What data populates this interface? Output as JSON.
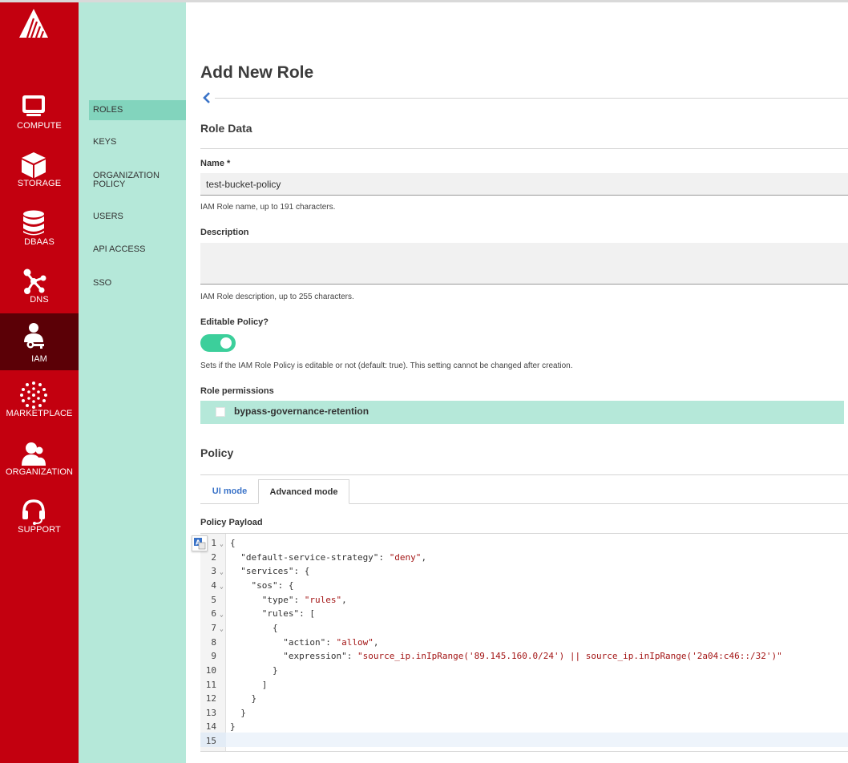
{
  "nav": {
    "items": [
      {
        "label": "COMPUTE",
        "icon": "monitor-icon"
      },
      {
        "label": "STORAGE",
        "icon": "cube-icon"
      },
      {
        "label": "DBAAS",
        "icon": "database-icon"
      },
      {
        "label": "DNS",
        "icon": "network-icon"
      },
      {
        "label": "IAM",
        "icon": "user-key-icon",
        "active": true
      },
      {
        "label": "MARKETPLACE",
        "icon": "dots-circle-icon"
      },
      {
        "label": "ORGANIZATION",
        "icon": "users-icon"
      },
      {
        "label": "SUPPORT",
        "icon": "headset-icon"
      }
    ]
  },
  "subnav": {
    "items": [
      {
        "label": "ROLES",
        "active": true
      },
      {
        "label": "KEYS"
      },
      {
        "label": "ORGANIZATION\nPOLICY"
      },
      {
        "label": "USERS"
      },
      {
        "label": "API ACCESS"
      },
      {
        "label": "SSO"
      }
    ]
  },
  "page": {
    "title": "Add New Role",
    "role_data_heading": "Role Data",
    "name_label": "Name *",
    "name_value": "test-bucket-policy",
    "name_help": "IAM Role name, up to 191 characters.",
    "description_label": "Description",
    "description_value": "",
    "description_help": "IAM Role description, up to 255 characters.",
    "editable_label": "Editable Policy?",
    "editable_value": true,
    "editable_help": "Sets if the IAM Role Policy is editable or not (default: true). This setting cannot be changed after creation.",
    "permissions_label": "Role permissions",
    "permission_item": "bypass-governance-retention",
    "policy_heading": "Policy",
    "tabs": [
      "UI mode",
      "Advanced mode"
    ],
    "active_tab": "Advanced mode",
    "payload_label": "Policy Payload"
  },
  "colors": {
    "nav_bg": "#c3000f",
    "nav_active": "#5b0006",
    "subnav_bg": "#b5e8d9",
    "subnav_active": "#82d4bd",
    "toggle_on": "#3ccf9b",
    "link_blue": "#3a73c8",
    "string_red": "#a31515"
  },
  "editor": {
    "lines": [
      {
        "n": "1",
        "fold": true,
        "parts": [
          [
            "k",
            "{"
          ]
        ]
      },
      {
        "n": "2",
        "parts": [
          [
            "k",
            "  \"default-service-strategy\": "
          ],
          [
            "s",
            "\"deny\""
          ],
          [
            "k",
            ","
          ]
        ]
      },
      {
        "n": "3",
        "fold": true,
        "parts": [
          [
            "k",
            "  \"services\": {"
          ]
        ]
      },
      {
        "n": "4",
        "fold": true,
        "parts": [
          [
            "k",
            "    \"sos\": {"
          ]
        ]
      },
      {
        "n": "5",
        "parts": [
          [
            "k",
            "      \"type\": "
          ],
          [
            "s",
            "\"rules\""
          ],
          [
            "k",
            ","
          ]
        ]
      },
      {
        "n": "6",
        "fold": true,
        "parts": [
          [
            "k",
            "      \"rules\": ["
          ]
        ]
      },
      {
        "n": "7",
        "fold": true,
        "parts": [
          [
            "k",
            "        {"
          ]
        ]
      },
      {
        "n": "8",
        "parts": [
          [
            "k",
            "          \"action\": "
          ],
          [
            "s",
            "\"allow\""
          ],
          [
            "k",
            ","
          ]
        ]
      },
      {
        "n": "9",
        "parts": [
          [
            "k",
            "          \"expression\": "
          ],
          [
            "s",
            "\"source_ip.inIpRange('89.145.160.0/24') || source_ip.inIpRange('2a04:c46::/32')\""
          ]
        ]
      },
      {
        "n": "10",
        "parts": [
          [
            "k",
            "        }"
          ]
        ]
      },
      {
        "n": "11",
        "parts": [
          [
            "k",
            "      ]"
          ]
        ]
      },
      {
        "n": "12",
        "parts": [
          [
            "k",
            "    }"
          ]
        ]
      },
      {
        "n": "13",
        "parts": [
          [
            "k",
            "  }"
          ]
        ]
      },
      {
        "n": "14",
        "parts": [
          [
            "k",
            "}"
          ]
        ]
      },
      {
        "n": "15",
        "parts": []
      }
    ]
  }
}
